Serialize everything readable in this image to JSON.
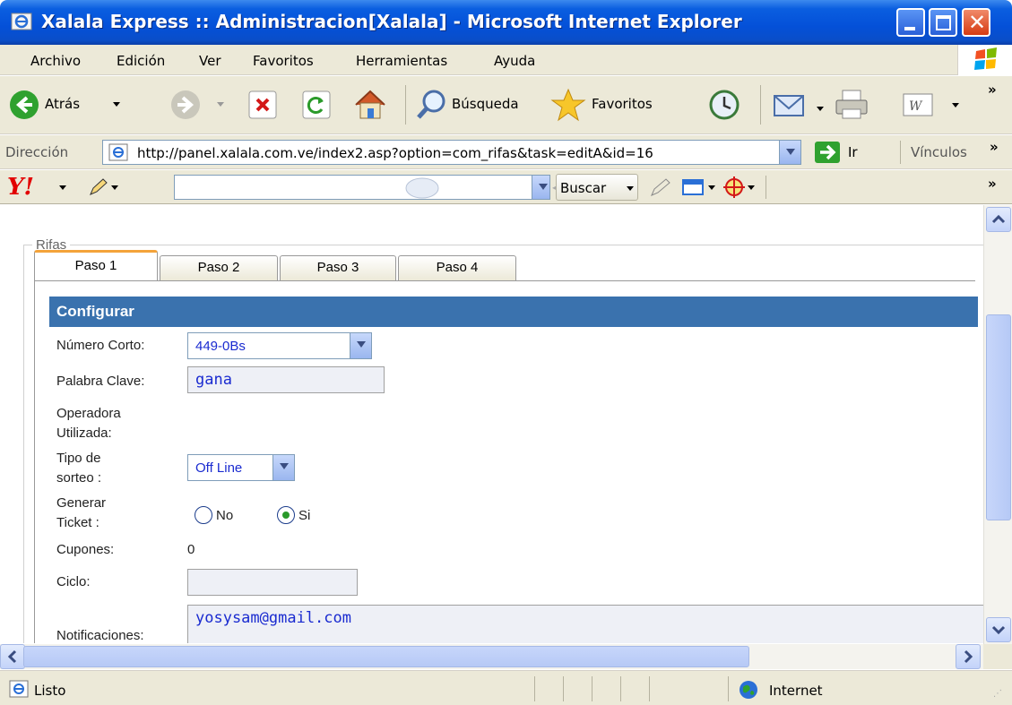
{
  "window": {
    "title": "Xalala Express :: Administracion[Xalala] - Microsoft Internet Explorer"
  },
  "menubar": {
    "items": [
      {
        "label": "Archivo"
      },
      {
        "label": "Edición"
      },
      {
        "label": "Ver"
      },
      {
        "label": "Favoritos"
      },
      {
        "label": "Herramientas"
      },
      {
        "label": "Ayuda"
      }
    ]
  },
  "toolbar": {
    "back_label": "Atrás",
    "search_label": "Búsqueda",
    "favorites_label": "Favoritos"
  },
  "address": {
    "label": "Dirección",
    "url": "http://panel.xalala.com.ve/index2.asp?option=com_rifas&task=editA&id=16",
    "go_label": "Ir",
    "links_label": "Vínculos"
  },
  "yahoo": {
    "search_button": "Buscar",
    "search_value": ""
  },
  "form": {
    "legend": "Rifas",
    "tabs": [
      {
        "label": "Paso 1",
        "active": true
      },
      {
        "label": "Paso 2",
        "active": false
      },
      {
        "label": "Paso 3",
        "active": false
      },
      {
        "label": "Paso 4",
        "active": false
      }
    ],
    "section_title": "Configurar",
    "numero_corto": {
      "label": "Número Corto:",
      "value": "449-0Bs"
    },
    "palabra_clave": {
      "label": "Palabra Clave:",
      "value": "gana"
    },
    "operadora": {
      "label_line1": "Operadora",
      "label_line2": "Utilizada:"
    },
    "tipo_sorteo": {
      "label_line1": "Tipo de",
      "label_line2": "sorteo :",
      "value": "Off Line"
    },
    "generar_ticket": {
      "label_line1": "Generar",
      "label_line2": "Ticket :",
      "option_no": "No",
      "option_si": "Si",
      "selected": "Si"
    },
    "cupones": {
      "label": "Cupones:",
      "value": "0"
    },
    "ciclo": {
      "label": "Ciclo:",
      "value": ""
    },
    "notificaciones": {
      "label": "Notificaciones:",
      "value": "yosysam@gmail.com"
    }
  },
  "status": {
    "text": "Listo",
    "zone": "Internet"
  },
  "colors": {
    "titlebar": "#0450d8",
    "section_header": "#3a72ae",
    "active_tab_accent": "#f4a33a",
    "input_text": "#1a2bd0"
  }
}
